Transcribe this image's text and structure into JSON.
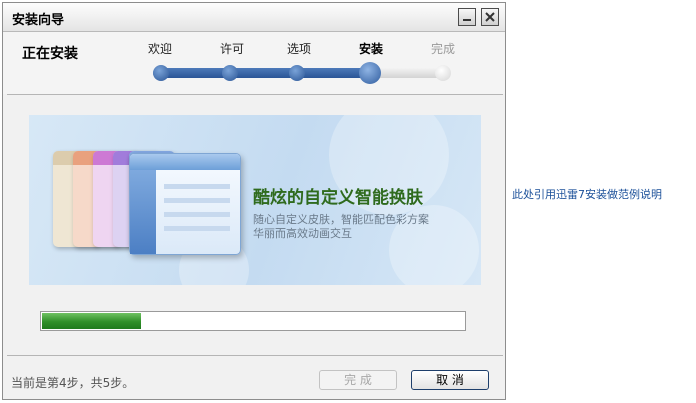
{
  "window": {
    "title": "安装向导",
    "minimize_label": "minimize",
    "close_label": "close"
  },
  "header": {
    "stage_title": "正在安装",
    "steps": [
      {
        "label": "欢迎",
        "state": "done"
      },
      {
        "label": "许可",
        "state": "done"
      },
      {
        "label": "选项",
        "state": "done"
      },
      {
        "label": "安装",
        "state": "current"
      },
      {
        "label": "完成",
        "state": "todo"
      }
    ]
  },
  "banner": {
    "headline": "酷炫的自定义智能换肤",
    "sub_line1": "随心自定义皮肤，智能匹配色彩方案",
    "sub_line2": "华丽而高效动画交互",
    "skin_colors": [
      "#d9c9a9",
      "#e89a76",
      "#c96fd0",
      "#9a72d8",
      "#7aa0df"
    ]
  },
  "progress": {
    "fraction": 0.235,
    "fill_color": "#2f8f28"
  },
  "footer": {
    "status": "当前是第4步，共5步。",
    "finish_label": "完  成",
    "cancel_label": "取 消"
  },
  "side_note": "此处引用迅雷7安装做范例说明",
  "colors": {
    "accent": "#2a5596",
    "headline": "#2f6b1e"
  }
}
